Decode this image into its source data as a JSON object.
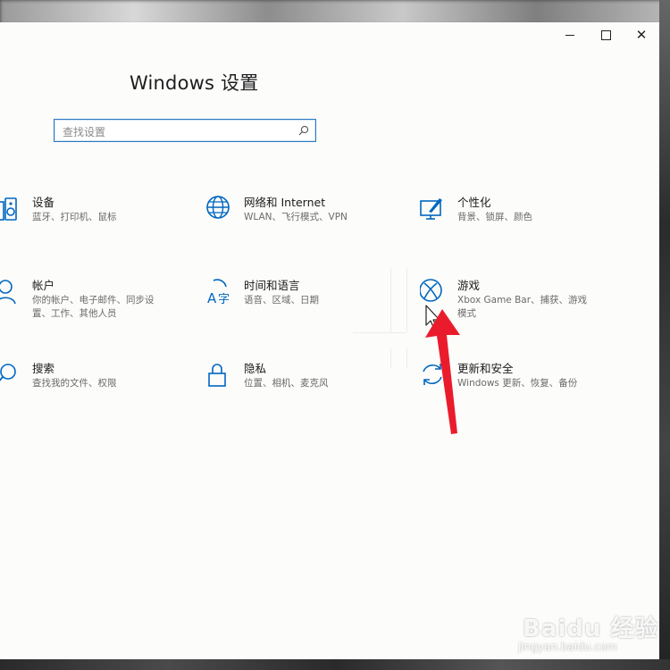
{
  "window": {
    "title": "Windows 设置",
    "accent": "#0067c0",
    "controls": {
      "min": "minimize-icon",
      "max": "maximize-icon",
      "close": "✕"
    }
  },
  "search": {
    "placeholder": "查找设置",
    "icon": "search-icon"
  },
  "items": [
    {
      "id": "devices",
      "title": "设备",
      "desc": [
        "蓝牙、打印机、鼠标"
      ],
      "icon": "keyboard-speaker-icon"
    },
    {
      "id": "network",
      "title": "网络和 Internet",
      "desc": [
        "WLAN、飞行模式、VPN"
      ],
      "icon": "globe-icon"
    },
    {
      "id": "personalization",
      "title": "个性化",
      "desc": [
        "背景、锁屏、颜色"
      ],
      "icon": "paint-display-icon"
    },
    {
      "id": "accounts",
      "title": "帐户",
      "desc": [
        "你的帐户、电子邮件、同步设",
        "置、工作、其他人员"
      ],
      "icon": "person-icon"
    },
    {
      "id": "time-language",
      "title": "时间和语言",
      "desc": [
        "语音、区域、日期"
      ],
      "icon": "time-language-icon"
    },
    {
      "id": "gaming",
      "title": "游戏",
      "desc": [
        "Xbox Game Bar、捕获、游戏",
        "模式"
      ],
      "icon": "xbox-icon"
    },
    {
      "id": "search",
      "title": "搜索",
      "desc": [
        "查找我的文件、权限"
      ],
      "icon": "magnifier-icon"
    },
    {
      "id": "privacy",
      "title": "隐私",
      "desc": [
        "位置、相机、麦克风"
      ],
      "icon": "lock-icon"
    },
    {
      "id": "update-security",
      "title": "更新和安全",
      "desc": [
        "Windows 更新、恢复、备份"
      ],
      "icon": "sync-arrows-icon"
    }
  ],
  "watermark": {
    "logo": "Baidu 经验",
    "url": "jingyan.baidu.com"
  }
}
